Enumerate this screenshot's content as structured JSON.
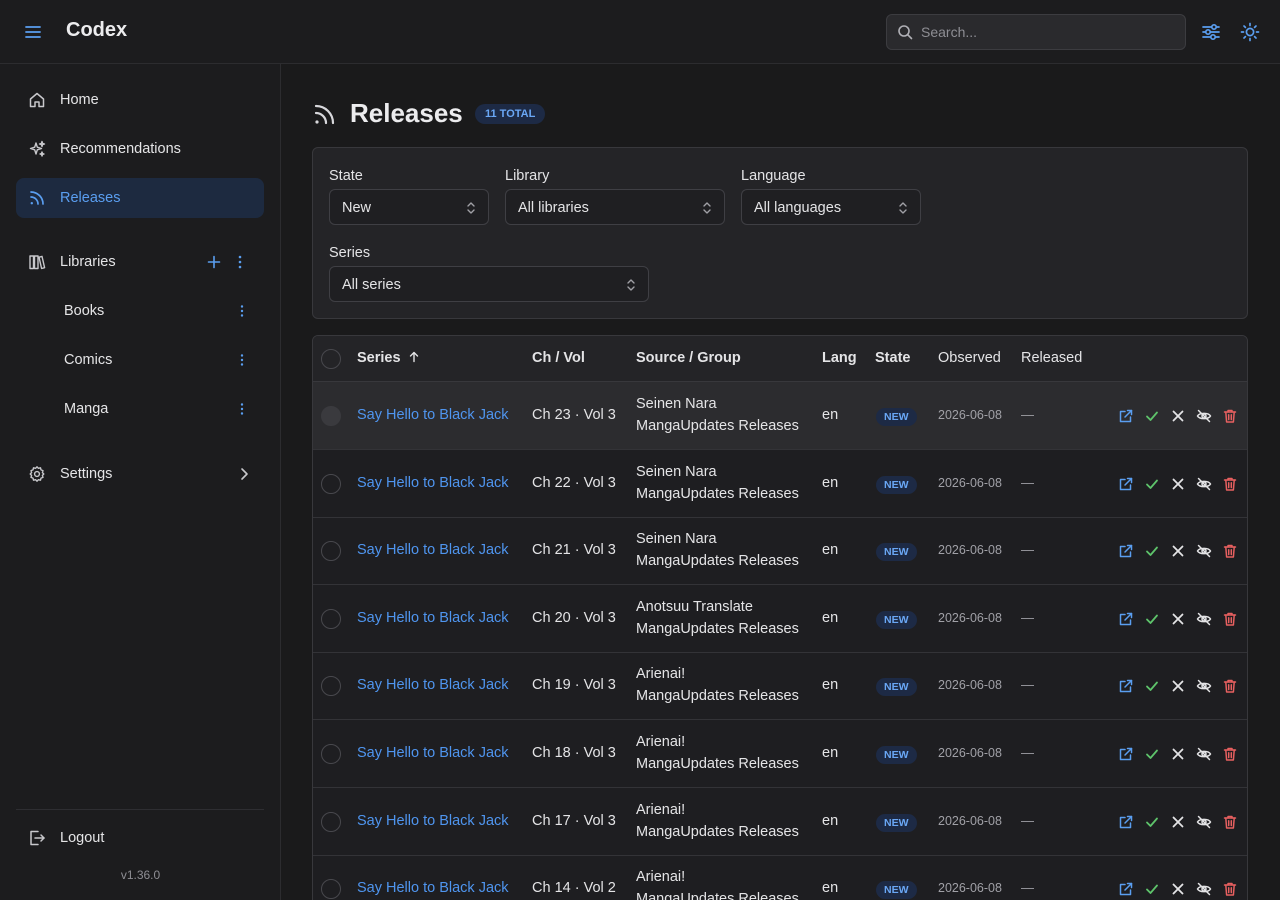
{
  "app": {
    "name": "Codex"
  },
  "search": {
    "placeholder": "Search..."
  },
  "sidebar": {
    "nav": [
      {
        "label": "Home",
        "icon": "home-icon"
      },
      {
        "label": "Recommendations",
        "icon": "sparkles-icon"
      },
      {
        "label": "Releases",
        "icon": "rss-icon",
        "active": true
      }
    ],
    "libraries_label": "Libraries",
    "libraries": [
      "Books",
      "Comics",
      "Manga"
    ],
    "settings_label": "Settings",
    "logout_label": "Logout",
    "version": "v1.36.0"
  },
  "page": {
    "title": "Releases",
    "total_badge": "11 TOTAL"
  },
  "filters": {
    "state": {
      "label": "State",
      "value": "New"
    },
    "library": {
      "label": "Library",
      "value": "All libraries"
    },
    "language": {
      "label": "Language",
      "value": "All languages"
    },
    "series": {
      "label": "Series",
      "value": "All series"
    }
  },
  "table": {
    "columns": [
      "Series",
      "Ch / Vol",
      "Source / Group",
      "Lang",
      "State",
      "Observed",
      "Released"
    ],
    "sort": {
      "column": "Series",
      "direction": "asc"
    },
    "rows": [
      {
        "series": "Say Hello to Black Jack",
        "chvol": "Ch 23 · Vol 3",
        "source": "Seinen Nara",
        "group": "MangaUpdates Releases",
        "lang": "en",
        "state": "NEW",
        "observed": "2026-06-08",
        "released": "—"
      },
      {
        "series": "Say Hello to Black Jack",
        "chvol": "Ch 22 · Vol 3",
        "source": "Seinen Nara",
        "group": "MangaUpdates Releases",
        "lang": "en",
        "state": "NEW",
        "observed": "2026-06-08",
        "released": "—"
      },
      {
        "series": "Say Hello to Black Jack",
        "chvol": "Ch 21 · Vol 3",
        "source": "Seinen Nara",
        "group": "MangaUpdates Releases",
        "lang": "en",
        "state": "NEW",
        "observed": "2026-06-08",
        "released": "—"
      },
      {
        "series": "Say Hello to Black Jack",
        "chvol": "Ch 20 · Vol 3",
        "source": "Anotsuu Translate",
        "group": "MangaUpdates Releases",
        "lang": "en",
        "state": "NEW",
        "observed": "2026-06-08",
        "released": "—"
      },
      {
        "series": "Say Hello to Black Jack",
        "chvol": "Ch 19 · Vol 3",
        "source": "Arienai!",
        "group": "MangaUpdates Releases",
        "lang": "en",
        "state": "NEW",
        "observed": "2026-06-08",
        "released": "—"
      },
      {
        "series": "Say Hello to Black Jack",
        "chvol": "Ch 18 · Vol 3",
        "source": "Arienai!",
        "group": "MangaUpdates Releases",
        "lang": "en",
        "state": "NEW",
        "observed": "2026-06-08",
        "released": "—"
      },
      {
        "series": "Say Hello to Black Jack",
        "chvol": "Ch 17 · Vol 3",
        "source": "Arienai!",
        "group": "MangaUpdates Releases",
        "lang": "en",
        "state": "NEW",
        "observed": "2026-06-08",
        "released": "—"
      },
      {
        "series": "Say Hello to Black Jack",
        "chvol": "Ch 14 · Vol 2",
        "source": "Arienai!",
        "group": "MangaUpdates Releases",
        "lang": "en",
        "state": "NEW",
        "observed": "2026-06-08",
        "released": "—"
      }
    ],
    "row_actions": [
      "external-link-icon",
      "check-icon",
      "close-icon",
      "eye-off-icon",
      "trash-icon"
    ]
  },
  "colors": {
    "accent": "#5a9ef0",
    "link": "#4f95ef",
    "success": "#5ec46b",
    "danger": "#e86060",
    "badge_bg": "#1d2a45"
  }
}
